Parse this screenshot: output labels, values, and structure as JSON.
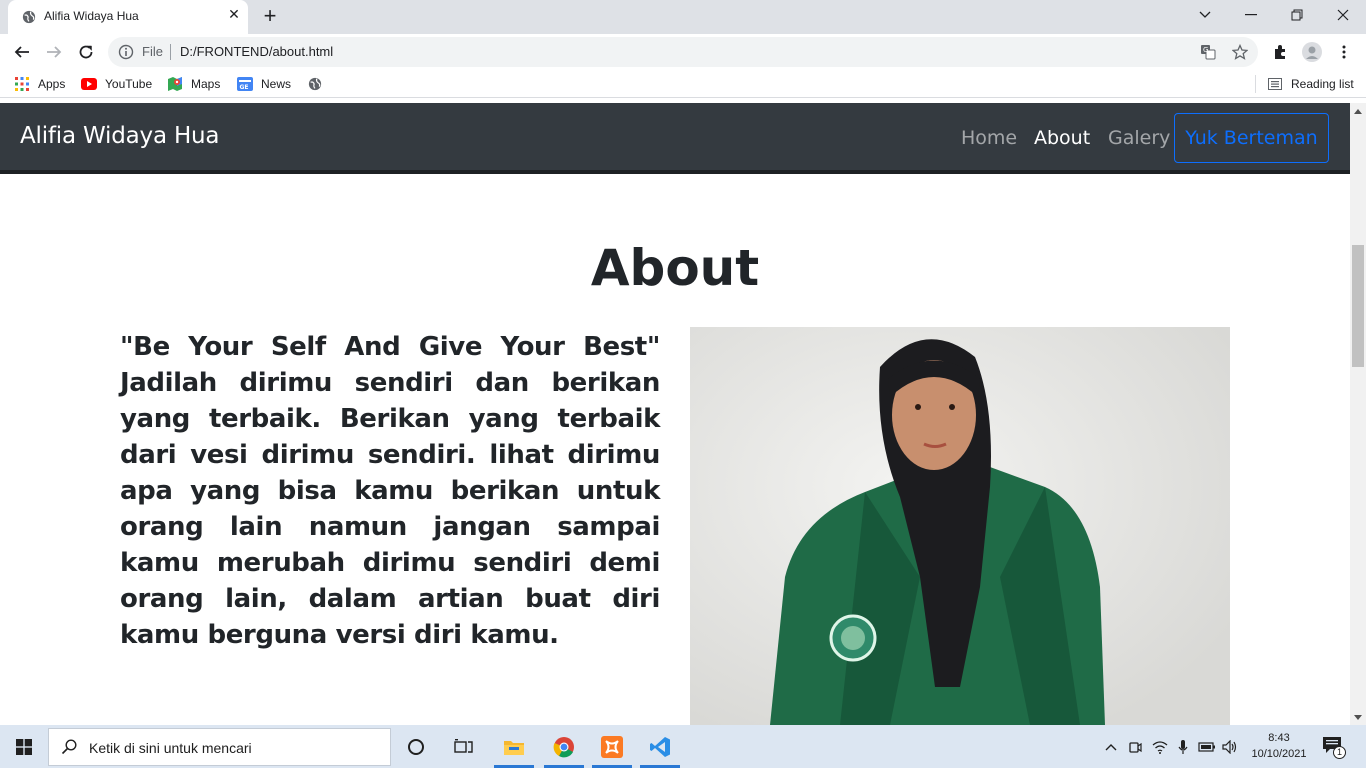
{
  "browser": {
    "tab_title": "Alifia Widaya Hua",
    "omnibox_scheme": "File",
    "url": "D:/FRONTEND/about.html",
    "bookmarks": [
      "Apps",
      "YouTube",
      "Maps",
      "News"
    ],
    "reading_list": "Reading list"
  },
  "navbar": {
    "brand": "Alifia Widaya Hua",
    "links": [
      "Home",
      "About",
      "Galery"
    ],
    "active_link": "About",
    "cta": "Yuk Berteman",
    "cta_color": "#0d6efd",
    "background": "#343a40"
  },
  "about": {
    "title": "About",
    "quote": "\"Be Your Self And Give Your Best\" Jadilah dirimu sendiri dan berikan yang terbaik. Berikan yang terbaik dari vesi dirimu sendiri. lihat dirimu apa yang bisa kamu berikan untuk orang lain namun jangan sampai kamu merubah dirimu sendiri demi orang lain, dalam artian buat diri kamu berguna versi diri kamu."
  },
  "taskbar": {
    "search_placeholder": "Ketik di sini untuk mencari",
    "time": "8:43",
    "date": "10/10/2021",
    "notification_count": "1",
    "apps": [
      "cortana-icon",
      "task-view-icon",
      "file-explorer-icon",
      "chrome-icon",
      "xampp-icon",
      "vscode-icon"
    ]
  }
}
